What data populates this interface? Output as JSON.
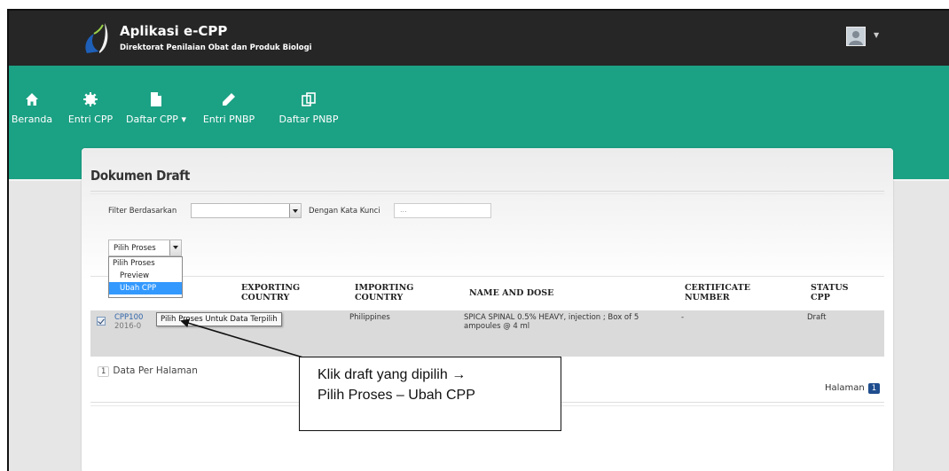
{
  "header": {
    "app_title": "Aplikasi e-CPP",
    "app_subtitle": "Direktorat Penilaian Obat dan Produk Biologi"
  },
  "nav": [
    {
      "label": "Beranda",
      "icon": "home-icon"
    },
    {
      "label": "Entri CPP",
      "icon": "gear-icon"
    },
    {
      "label": "Daftar CPP",
      "icon": "file-icon"
    },
    {
      "label": "Entri PNBP",
      "icon": "pencil-icon"
    },
    {
      "label": "Daftar PNBP",
      "icon": "copy-icon"
    }
  ],
  "nav_caret": "▾",
  "panel": {
    "title": "Dokumen Draft",
    "filter_label": "Filter Berdasarkan",
    "filter_value": "",
    "keyword_label": "Dengan Kata Kunci",
    "keyword_placeholder": "..."
  },
  "proses": {
    "selected": "Pilih Proses",
    "options": [
      "Pilih Proses",
      "Preview",
      "Ubah CPP"
    ],
    "active_option": "Ubah CPP"
  },
  "table": {
    "columns": [
      "EXPORTING COUNTRY",
      "IMPORTING COUNTRY",
      "NAME AND DOSE",
      "CERTIFICATE NUMBER",
      "STATUS CPP"
    ],
    "rows": [
      {
        "checked": true,
        "id": "CPP100",
        "date": "2016-0",
        "importing_country": "Philippines",
        "name_and_dose": "SPICA SPINAL 0.5% HEAVY, injection ; Box of 5 ampoules @ 4 ml",
        "certificate_number": "-",
        "status": "Draft"
      }
    ]
  },
  "tooltip": "Pilih Proses Untuk Data Terpilih",
  "pagination": {
    "per_page_value": "1",
    "per_page_label": "Data Per Halaman",
    "page_label": "Halaman",
    "page_value": "1"
  },
  "callout": {
    "line1": "Klik draft yang dipilih →",
    "line2": "Pilih Proses – Ubah CPP"
  },
  "colors": {
    "topbar": "#262626",
    "green": "#1ba184",
    "accent_blue": "#3399ff",
    "badge_blue": "#1f4e8e"
  }
}
